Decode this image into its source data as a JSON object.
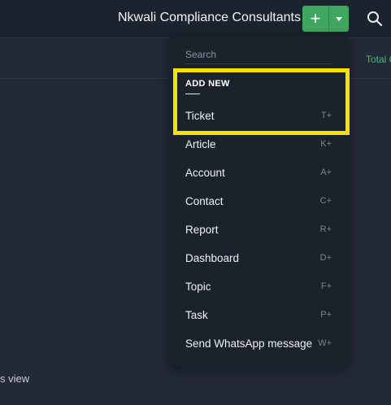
{
  "header": {
    "org_name": "Nkwali Compliance Consultants",
    "add_icon": "plus-icon",
    "caret_icon": "caret-down-icon",
    "search_icon": "search-icon"
  },
  "subbar": {
    "total_label": "Total C"
  },
  "background": {
    "view_text": "s view"
  },
  "dropdown": {
    "search_placeholder": "Search",
    "section_title": "ADD NEW",
    "items": [
      {
        "label": "Ticket",
        "shortcut": "T+"
      },
      {
        "label": "Article",
        "shortcut": "K+"
      },
      {
        "label": "Account",
        "shortcut": "A+"
      },
      {
        "label": "Contact",
        "shortcut": "C+"
      },
      {
        "label": "Report",
        "shortcut": "R+"
      },
      {
        "label": "Dashboard",
        "shortcut": "D+"
      },
      {
        "label": "Topic",
        "shortcut": "F+"
      },
      {
        "label": "Task",
        "shortcut": "P+"
      },
      {
        "label": "Send WhatsApp message",
        "shortcut": "W+"
      }
    ]
  },
  "colors": {
    "accent_green": "#3fa660",
    "highlight_yellow": "#f5e200",
    "dropdown_bg": "#1c222c",
    "page_bg": "#232a37"
  }
}
